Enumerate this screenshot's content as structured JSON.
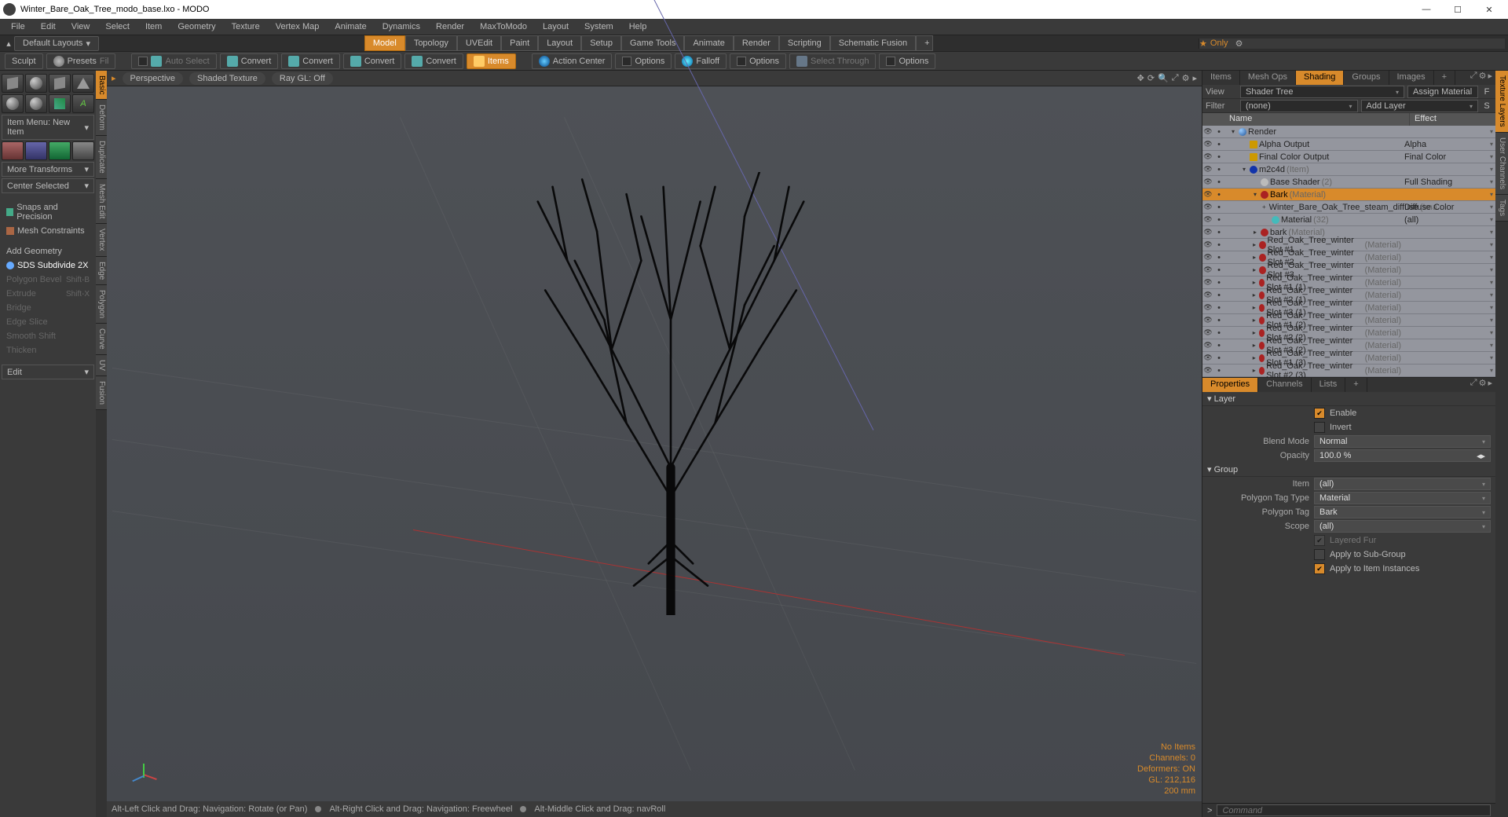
{
  "title": "Winter_Bare_Oak_Tree_modo_base.lxo - MODO",
  "menu": [
    "File",
    "Edit",
    "View",
    "Select",
    "Item",
    "Geometry",
    "Texture",
    "Vertex Map",
    "Animate",
    "Dynamics",
    "Render",
    "MaxToModo",
    "Layout",
    "System",
    "Help"
  ],
  "layout_dropdown": "Default Layouts",
  "main_tabs": [
    "Model",
    "Topology",
    "UVEdit",
    "Paint",
    "Layout",
    "Setup",
    "Game Tools",
    "Animate",
    "Render",
    "Scripting",
    "Schematic Fusion"
  ],
  "main_tab_active": 0,
  "only_label": "Only",
  "toolbar": {
    "sculpt": "Sculpt",
    "presets": "Presets",
    "auto_select": "Auto Select",
    "convert": "Convert",
    "items": "Items",
    "action_center": "Action Center",
    "options": "Options",
    "falloff": "Falloff",
    "select_through": "Select Through"
  },
  "left": {
    "item_menu": "Item Menu: New Item",
    "more_transforms": "More Transforms",
    "center_selected": "Center Selected",
    "snaps": "Snaps and Precision",
    "mesh_constraints": "Mesh Constraints",
    "add_geometry": "Add Geometry",
    "sds": "SDS Subdivide 2X",
    "polygon_bevel": "Polygon Bevel",
    "extrude": "Extrude",
    "bridge": "Bridge",
    "edge_slice": "Edge Slice",
    "smooth_shift": "Smooth Shift",
    "thicken": "Thicken",
    "edit": "Edit",
    "shortcuts": {
      "bevel": "Shift-B",
      "extrude": "Shift-X"
    },
    "vtabs": [
      "Basic",
      "Deform",
      "Duplicate",
      "Mesh Edit",
      "Vertex",
      "Edge",
      "Polygon",
      "Curve",
      "UV",
      "Fusion"
    ]
  },
  "viewport": {
    "perspective": "Perspective",
    "shaded": "Shaded Texture",
    "raygl": "Ray GL: Off",
    "stats": {
      "noitems": "No Items",
      "channels": "Channels: 0",
      "deformers": "Deformers: ON",
      "gl": "GL: 212,116",
      "scale": "200 mm"
    },
    "hints": {
      "a": "Alt-Left Click and Drag: Navigation: Rotate (or Pan)",
      "b": "Alt-Right Click and Drag: Navigation: Freewheel",
      "c": "Alt-Middle Click and Drag: navRoll"
    }
  },
  "right": {
    "tabs": [
      "Items",
      "Mesh Ops",
      "Shading",
      "Groups",
      "Images"
    ],
    "tab_active": 2,
    "view_lbl": "View",
    "view_val": "Shader Tree",
    "assign": "Assign Material",
    "filter_lbl": "Filter",
    "filter_val": "(none)",
    "addlayer": "Add Layer",
    "cols": {
      "name": "Name",
      "effect": "Effect"
    },
    "tree": [
      {
        "d": 0,
        "i": "globe",
        "t": "Render",
        "eff": "",
        "exp": "▾"
      },
      {
        "d": 1,
        "i": "cube",
        "t": "Alpha Output",
        "eff": "Alpha"
      },
      {
        "d": 1,
        "i": "cube",
        "t": "Final Color Output",
        "eff": "Final Color"
      },
      {
        "d": 1,
        "i": "blue",
        "t": "m2c4d",
        "sub": "(Item)",
        "eff": "",
        "exp": "▾"
      },
      {
        "d": 2,
        "i": "gray",
        "t": "Base Shader",
        "sub": "(2)",
        "eff": "Full Shading"
      },
      {
        "d": 2,
        "i": "red",
        "t": "Bark",
        "sub": "(Material)",
        "eff": "",
        "sel": true,
        "exp": "▾"
      },
      {
        "d": 3,
        "i": "img",
        "t": "Winter_Bare_Oak_Tree_steam_diffuse",
        "sub": "(Ima...",
        "eff": "Diffuse Color",
        "plus": true
      },
      {
        "d": 3,
        "i": "teal",
        "t": "Material",
        "sub": "(32)",
        "eff": "(all)"
      },
      {
        "d": 2,
        "i": "red",
        "t": "bark",
        "sub": "(Material)",
        "eff": "",
        "exp": "▸"
      },
      {
        "d": 2,
        "i": "red",
        "t": "Red_Oak_Tree_winter Slot #1",
        "sub": "(Material)",
        "eff": "",
        "exp": "▸"
      },
      {
        "d": 2,
        "i": "red",
        "t": "Red_Oak_Tree_winter Slot #2",
        "sub": "(Material)",
        "eff": "",
        "exp": "▸"
      },
      {
        "d": 2,
        "i": "red",
        "t": "Red_Oak_Tree_winter Slot #3",
        "sub": "(Material)",
        "eff": "",
        "exp": "▸"
      },
      {
        "d": 2,
        "i": "red",
        "t": "Red_Oak_Tree_winter Slot #1 (1)",
        "sub": "(Material)",
        "eff": "",
        "exp": "▸"
      },
      {
        "d": 2,
        "i": "red",
        "t": "Red_Oak_Tree_winter Slot #2 (1)",
        "sub": "(Material)",
        "eff": "",
        "exp": "▸"
      },
      {
        "d": 2,
        "i": "red",
        "t": "Red_Oak_Tree_winter Slot #3 (1)",
        "sub": "(Material)",
        "eff": "",
        "exp": "▸"
      },
      {
        "d": 2,
        "i": "red",
        "t": "Red_Oak_Tree_winter Slot #1 (2)",
        "sub": "(Material)",
        "eff": "",
        "exp": "▸"
      },
      {
        "d": 2,
        "i": "red",
        "t": "Red_Oak_Tree_winter Slot #2 (2)",
        "sub": "(Material)",
        "eff": "",
        "exp": "▸"
      },
      {
        "d": 2,
        "i": "red",
        "t": "Red_Oak_Tree_winter Slot #3 (2)",
        "sub": "(Material)",
        "eff": "",
        "exp": "▸"
      },
      {
        "d": 2,
        "i": "red",
        "t": "Red_Oak_Tree_winter Slot #1 (3)",
        "sub": "(Material)",
        "eff": "",
        "exp": "▸"
      },
      {
        "d": 2,
        "i": "red",
        "t": "Red_Oak_Tree_winter Slot #2 (3)",
        "sub": "(Material)",
        "eff": "",
        "exp": "▸"
      }
    ],
    "props_tabs": [
      "Properties",
      "Channels",
      "Lists"
    ],
    "layer": {
      "title": "Layer",
      "enable": "Enable",
      "invert": "Invert",
      "blend_lbl": "Blend Mode",
      "blend_val": "Normal",
      "opacity_lbl": "Opacity",
      "opacity_val": "100.0 %"
    },
    "group": {
      "title": "Group",
      "item_lbl": "Item",
      "item_val": "(all)",
      "ptt_lbl": "Polygon Tag Type",
      "ptt_val": "Material",
      "pt_lbl": "Polygon Tag",
      "pt_val": "Bark",
      "scope_lbl": "Scope",
      "scope_val": "(all)",
      "layered_fur": "Layered Fur",
      "apply_sub": "Apply to Sub-Group",
      "apply_inst": "Apply to Item Instances"
    },
    "vtabs": [
      "Texture Layers",
      "User Channels",
      "Tags"
    ]
  },
  "cmd_placeholder": "Command"
}
